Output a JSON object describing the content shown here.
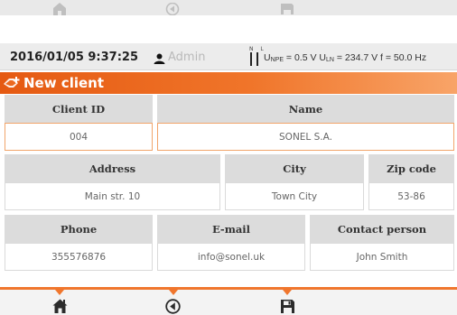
{
  "status": {
    "datetime": "2016/01/05 9:37:25",
    "user": "Admin",
    "nl_label": "N L",
    "measurement": {
      "u_npe_label": "U",
      "u_npe_sub": "NPE",
      "u_npe_value": " = 0.5 V ",
      "u_ln_label": "U",
      "u_ln_sub": "LN",
      "u_ln_value": " = 234.7 V ",
      "f_text": "f = 50.0 Hz"
    }
  },
  "title": "New client",
  "form": {
    "row1": {
      "client_id_label": "Client ID",
      "client_id_value": "004",
      "name_label": "Name",
      "name_value": "SONEL S.A."
    },
    "row2": {
      "address_label": "Address",
      "address_value": "Main str. 10",
      "city_label": "City",
      "city_value": "Town City",
      "zip_label": "Zip code",
      "zip_value": "53-86"
    },
    "row3": {
      "phone_label": "Phone",
      "phone_value": "355576876",
      "email_label": "E-mail",
      "email_value": "info@sonel.uk",
      "contact_label": "Contact person",
      "contact_value": "John Smith"
    }
  },
  "toolbar": {
    "icons": [
      "home-icon",
      "back-icon",
      "save-icon"
    ]
  },
  "colors": {
    "accent": "#f0762d",
    "header_bg": "#dcdcdc",
    "selected_border": "#f1a56b"
  }
}
